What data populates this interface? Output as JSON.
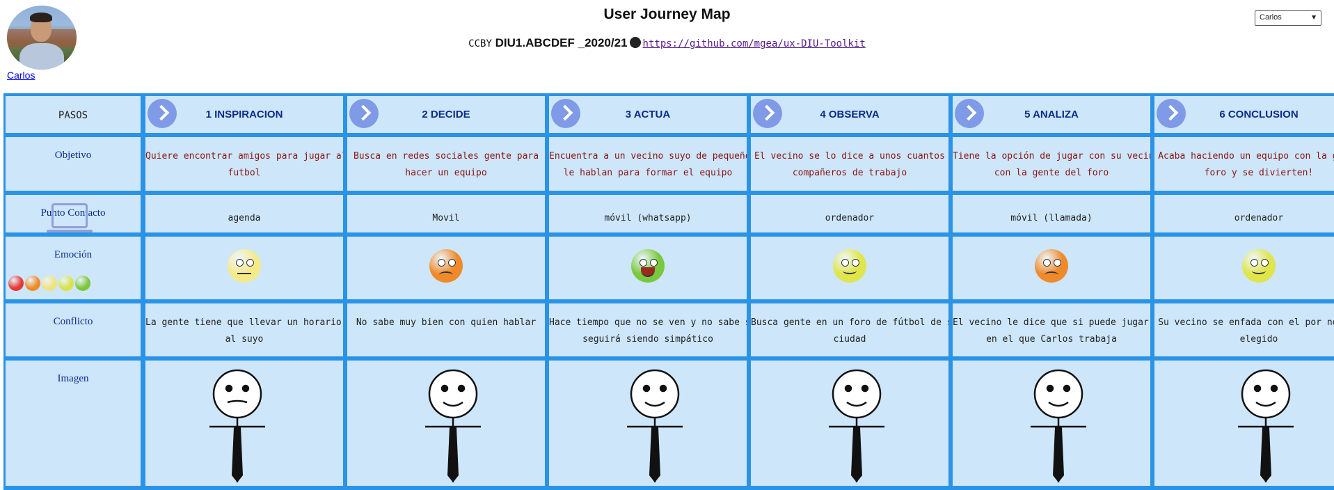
{
  "header": {
    "title": "User Journey Map",
    "license": "CCBY",
    "course_code": "DIU1.ABCDEF _2020/21",
    "repo_link": "https://github.com/mgea/ux-DIU-Toolkit",
    "user_link": "Carlos",
    "persona_select": "Carlos"
  },
  "table": {
    "row_labels": {
      "steps": "PASOS",
      "objective": "Objetivo",
      "contact": "Punto Contacto",
      "emotion": "Emoción",
      "conflict": "Conflicto",
      "image": "Imagen"
    },
    "steps": [
      {
        "title": "1 INSPIRACION",
        "objective": [
          "Quiere encontrar amigos para jugar al",
          "futbol"
        ],
        "contact": "agenda",
        "emotion": "neutral",
        "conflict": [
          "La gente tiene que llevar un horario similar",
          "al suyo"
        ]
      },
      {
        "title": "2 DECIDE",
        "objective": [
          "Busca en redes sociales gente para",
          "hacer un equipo"
        ],
        "contact": "Movil",
        "emotion": "angry",
        "conflict": [
          "No sabe muy bien con quien hablar"
        ]
      },
      {
        "title": "3 ACTUA",
        "objective": [
          "Encuentra a un vecino suyo de pequeño y",
          "le hablan para formar el equipo"
        ],
        "contact": "móvil (whatsapp)",
        "emotion": "very-happy",
        "conflict": [
          "Hace tiempo que no se ven y no sabe si",
          "seguirá siendo simpático"
        ]
      },
      {
        "title": "4 OBSERVA",
        "objective": [
          "El vecino se lo dice a unos cuantos",
          "compañeros de trabajo"
        ],
        "contact": "ordenador",
        "emotion": "happy",
        "conflict": [
          "Busca gente en un foro de fútbol de su",
          "ciudad"
        ]
      },
      {
        "title": "5 ANALIZA",
        "objective": [
          "Tiene la opción de jugar con su vecino o",
          "con la gente del foro"
        ],
        "contact": "móvil (llamada)",
        "emotion": "angry",
        "conflict": [
          "El vecino le dice que si puede jugar un día",
          "en el que Carlos trabaja"
        ]
      },
      {
        "title": "6 CONCLUSION",
        "objective": [
          "Acaba haciendo un equipo con la gente",
          "foro y se divierten!"
        ],
        "contact": "ordenador",
        "emotion": "happy",
        "conflict": [
          "Su vecino se enfada con el por no hab",
          "elegido"
        ]
      }
    ]
  },
  "colors": {
    "grid": "#2b93e6",
    "cell": "#cde6fa",
    "heading": "#0b2b8a",
    "objective_text": "#8a1414",
    "arrow": "#7f9ae6"
  }
}
